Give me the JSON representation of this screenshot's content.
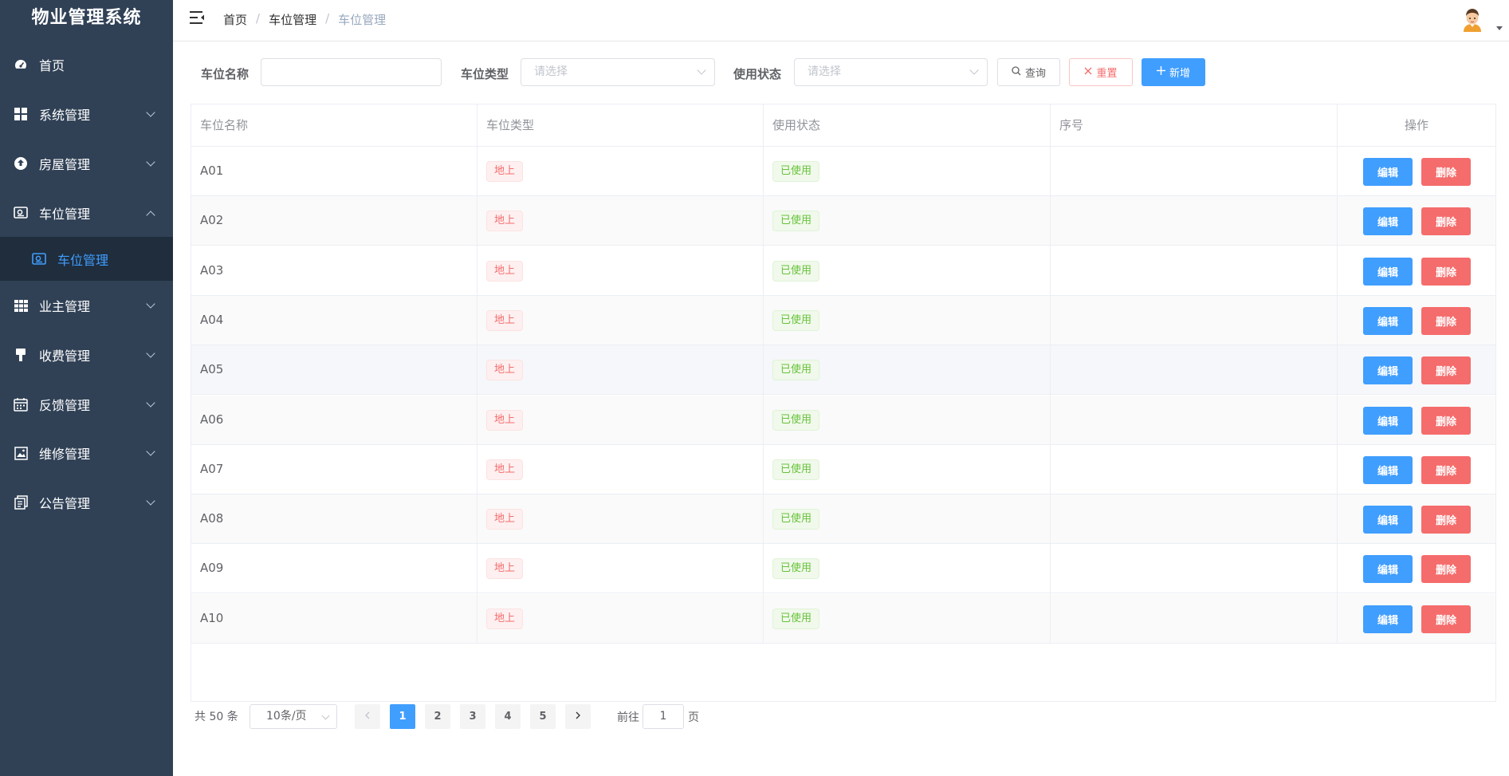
{
  "app": {
    "title": "物业管理系统"
  },
  "sidebar": {
    "items": [
      {
        "label": "首页",
        "icon": "dashboard-icon"
      },
      {
        "label": "系统管理",
        "icon": "grid-icon"
      },
      {
        "label": "房屋管理",
        "icon": "house-icon"
      },
      {
        "label": "车位管理",
        "icon": "parking-icon",
        "expanded": true
      },
      {
        "label": "业主管理",
        "icon": "table-icon"
      },
      {
        "label": "收费管理",
        "icon": "brush-icon"
      },
      {
        "label": "反馈管理",
        "icon": "calendar-icon"
      },
      {
        "label": "维修管理",
        "icon": "picture-icon"
      },
      {
        "label": "公告管理",
        "icon": "document-icon"
      }
    ],
    "active_sub": {
      "label": "车位管理",
      "icon": "parking-icon"
    }
  },
  "header": {
    "breadcrumb": [
      "首页",
      "车位管理",
      "车位管理"
    ],
    "breadcrumb_sep": "/"
  },
  "filters": {
    "name_label": "车位名称",
    "name_value": "",
    "type_label": "车位类型",
    "type_placeholder": "请选择",
    "status_label": "使用状态",
    "status_placeholder": "请选择",
    "query_label": "查询",
    "reset_label": "重置",
    "add_label": "新增"
  },
  "table": {
    "columns": [
      "车位名称",
      "车位类型",
      "使用状态",
      "序号",
      "操作"
    ],
    "rows": [
      {
        "name": "A01",
        "type": "地上",
        "status": "已使用",
        "seq": ""
      },
      {
        "name": "A02",
        "type": "地上",
        "status": "已使用",
        "seq": ""
      },
      {
        "name": "A03",
        "type": "地上",
        "status": "已使用",
        "seq": ""
      },
      {
        "name": "A04",
        "type": "地上",
        "status": "已使用",
        "seq": ""
      },
      {
        "name": "A05",
        "type": "地上",
        "status": "已使用",
        "seq": ""
      },
      {
        "name": "A06",
        "type": "地上",
        "status": "已使用",
        "seq": ""
      },
      {
        "name": "A07",
        "type": "地上",
        "status": "已使用",
        "seq": ""
      },
      {
        "name": "A08",
        "type": "地上",
        "status": "已使用",
        "seq": ""
      },
      {
        "name": "A09",
        "type": "地上",
        "status": "已使用",
        "seq": ""
      },
      {
        "name": "A10",
        "type": "地上",
        "status": "已使用",
        "seq": ""
      }
    ],
    "edit_label": "编辑",
    "delete_label": "删除"
  },
  "pagination": {
    "total_text": "共 50 条",
    "page_size": "10条/页",
    "pages": [
      "1",
      "2",
      "3",
      "4",
      "5"
    ],
    "current_page": "1",
    "goto_label": "前往",
    "goto_value": "1",
    "page_suffix": "页"
  },
  "colors": {
    "sidebar_bg": "#304156",
    "primary": "#409eff",
    "danger": "#f56c6c",
    "success": "#67c23a"
  }
}
